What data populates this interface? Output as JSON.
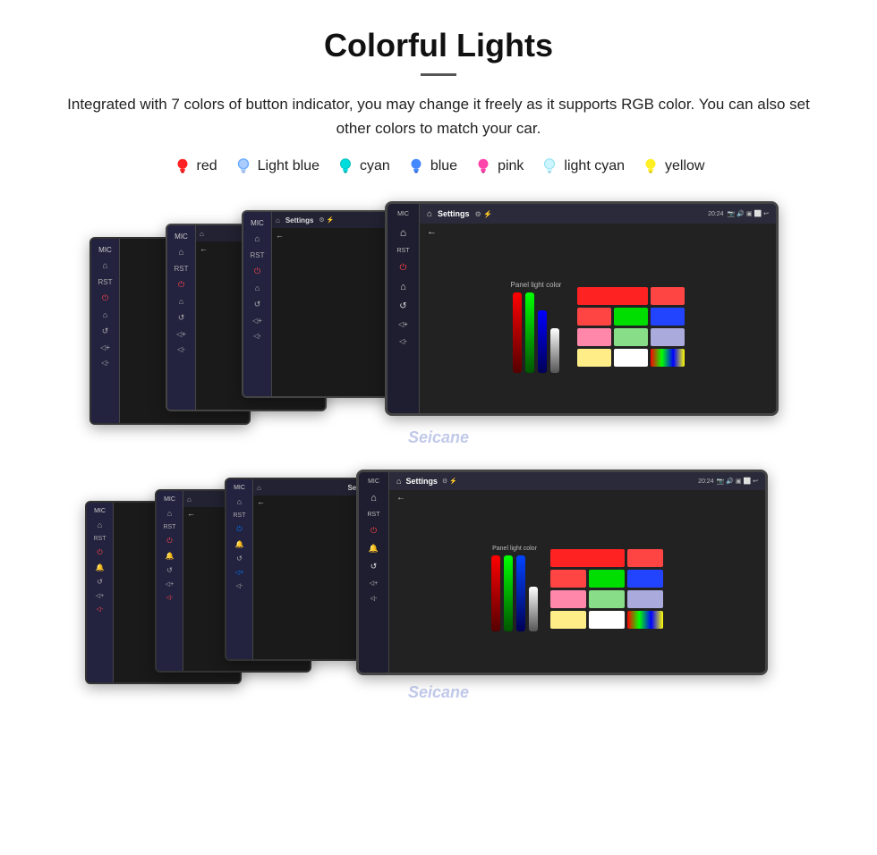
{
  "header": {
    "title": "Colorful Lights",
    "description": "Integrated with 7 colors of button indicator, you may change it freely as it supports RGB color. You can also set other colors to match your car."
  },
  "colors": [
    {
      "name": "red",
      "hex": "#ff2222",
      "type": "filled"
    },
    {
      "name": "Light blue",
      "hex": "#66aaff",
      "type": "outline"
    },
    {
      "name": "cyan",
      "hex": "#00dddd",
      "type": "outline"
    },
    {
      "name": "blue",
      "hex": "#2255ff",
      "type": "filled"
    },
    {
      "name": "pink",
      "hex": "#ff44aa",
      "type": "filled"
    },
    {
      "name": "light cyan",
      "hex": "#aaeeff",
      "type": "outline"
    },
    {
      "name": "yellow",
      "hex": "#ffee22",
      "type": "filled"
    }
  ],
  "device_screen": {
    "settings_title": "Settings",
    "panel_light_color": "Panel light color",
    "time": "20:24"
  },
  "watermark": "Seicane"
}
